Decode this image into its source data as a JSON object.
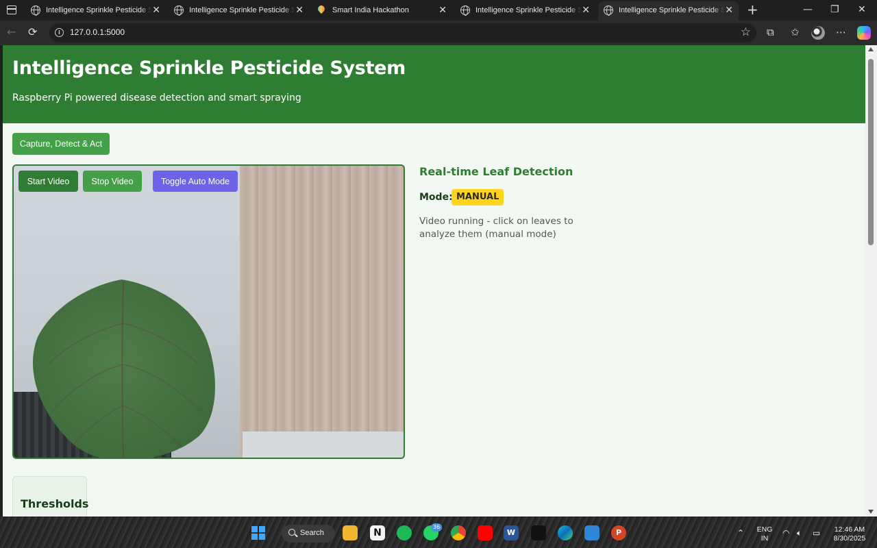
{
  "browser": {
    "tabs": [
      {
        "title": "Intelligence Sprinkle Pesticide Sy",
        "icon": "globe-icon",
        "active": false
      },
      {
        "title": "Intelligence Sprinkle Pesticide Sy",
        "icon": "globe-icon",
        "active": false
      },
      {
        "title": "Smart India Hackathon",
        "icon": "map-pin-icon",
        "active": false
      },
      {
        "title": "Intelligence Sprinkle Pesticide Sy",
        "icon": "globe-icon",
        "active": false
      },
      {
        "title": "Intelligence Sprinkle Pesticide Sy",
        "icon": "globe-icon",
        "active": true
      }
    ],
    "url": "127.0.0.1:5000"
  },
  "app": {
    "title": "Intelligence Sprinkle Pesticide System",
    "subtitle": "Raspberry Pi powered disease detection and smart spraying",
    "capture_button": "Capture, Detect & Act",
    "video_controls": {
      "start": "Start Video",
      "stop": "Stop Video",
      "toggle_auto": "Toggle Auto Mode"
    },
    "panel": {
      "title": "Real-time Leaf Detection",
      "mode_label": "Mode:",
      "mode_value": "MANUAL",
      "status": "Video running - click on leaves to analyze them (manual mode)"
    },
    "thresholds_title": "Thresholds"
  },
  "taskbar": {
    "search_label": "Search",
    "whatsapp_badge": "36",
    "language": "ENG",
    "region": "IN",
    "time": "12:46 AM",
    "date": "8/30/2025"
  },
  "colors": {
    "header_green": "#2e7d32",
    "button_green": "#43a047",
    "auto_purple": "#6c63e8",
    "mode_yellow": "#ffd41e",
    "page_bg": "#f2f8f2"
  }
}
